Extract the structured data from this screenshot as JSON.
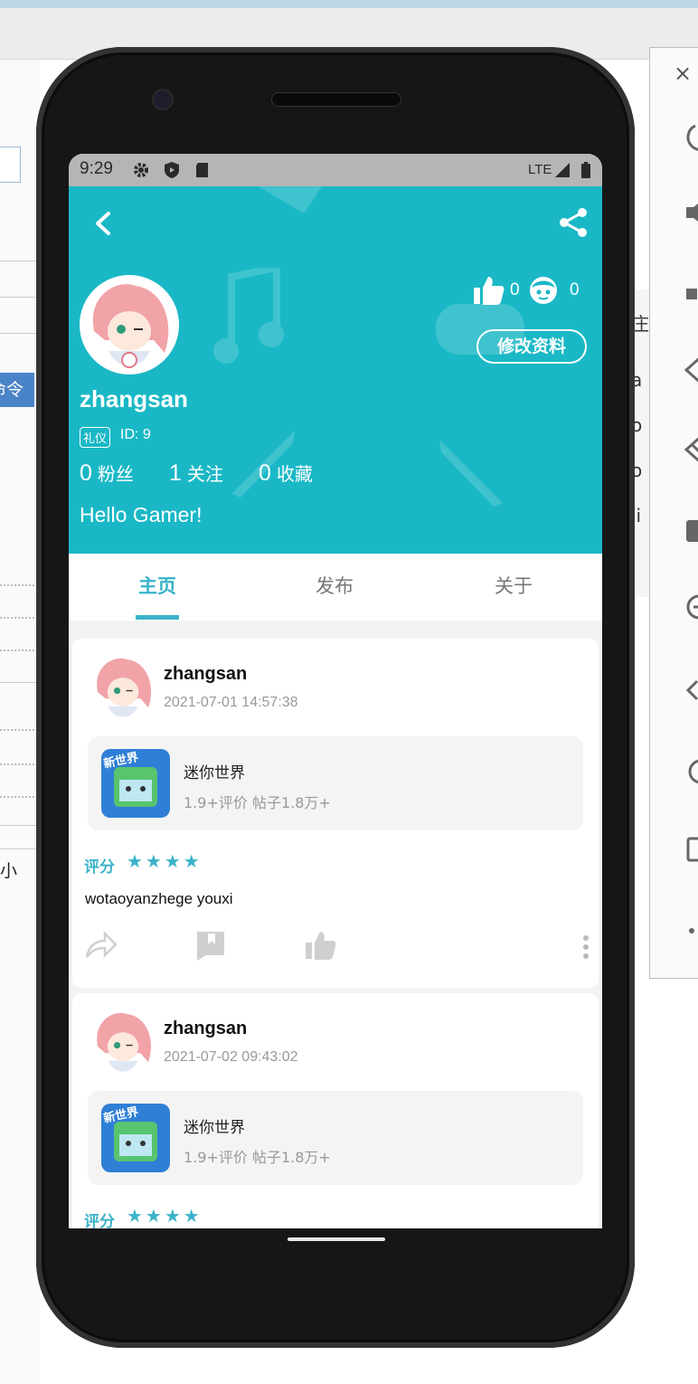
{
  "ide": {
    "left_highlight": "命令",
    "left_char": "小",
    "mid_chars": [
      "庄",
      "a",
      "o",
      "o",
      "li",
      "i"
    ]
  },
  "status_bar": {
    "time": "9:29",
    "network": "LTE",
    "icons": [
      "gear-icon",
      "shield-icon",
      "sd-card-icon",
      "signal-icon",
      "battery-icon"
    ]
  },
  "profile": {
    "username": "zhangsan",
    "badge": "礼仪",
    "id_text": "ID: 9",
    "likes": "0",
    "visitors": "0",
    "edit_label": "修改资料",
    "stats": [
      {
        "value": "0",
        "label": "粉丝"
      },
      {
        "value": "1",
        "label": "关注"
      },
      {
        "value": "0",
        "label": "收藏"
      }
    ],
    "bio": "Hello Gamer!"
  },
  "tabs": [
    {
      "label": "主页",
      "active": true
    },
    {
      "label": "发布",
      "active": false
    },
    {
      "label": "关于",
      "active": false
    }
  ],
  "posts": [
    {
      "author": "zhangsan",
      "time": "2021-07-01 14:57:38",
      "game": {
        "name": "迷你世界",
        "icon_text": "新世界",
        "meta": "1.9+评价  帖子1.8万+"
      },
      "rating_label": "评分",
      "stars": "★★★★",
      "text": "wotaoyanzhege youxi"
    },
    {
      "author": "zhangsan",
      "time": "2021-07-02 09:43:02",
      "game": {
        "name": "迷你世界",
        "icon_text": "新世界",
        "meta": "1.9+评价  帖子1.8万+"
      },
      "rating_label": "评分",
      "stars": "★★★★"
    }
  ],
  "colors": {
    "accent": "#1ab8c6",
    "tab_active": "#37b3c8",
    "star": "#3ab3c9"
  }
}
